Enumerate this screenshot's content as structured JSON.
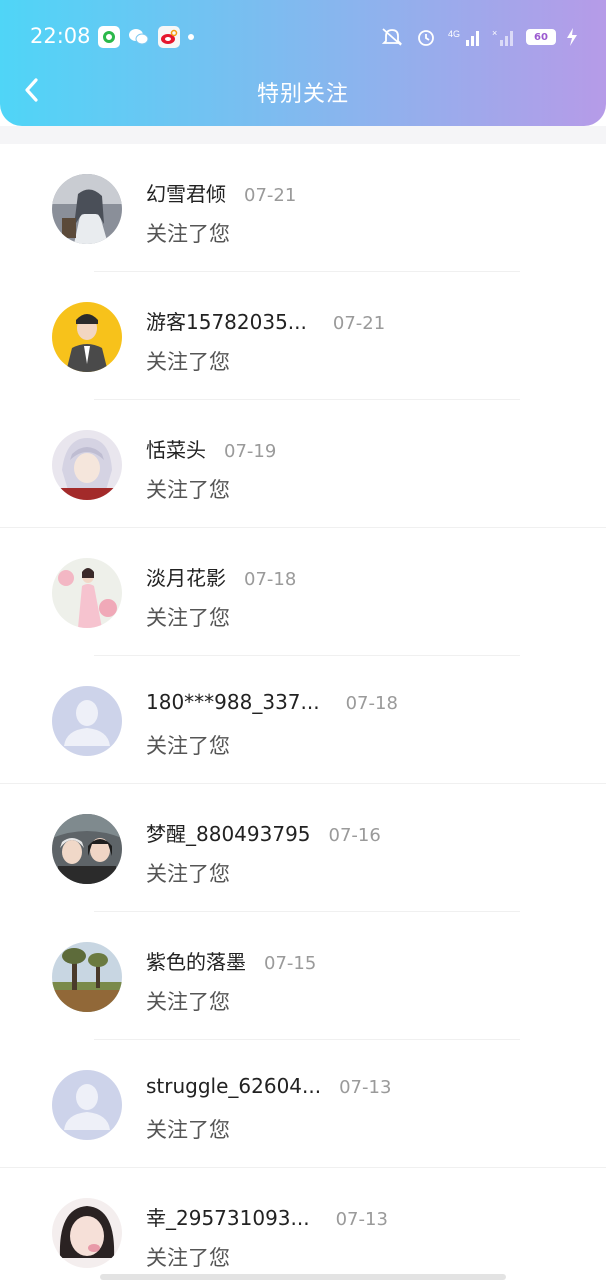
{
  "status_bar": {
    "time": "22:08",
    "notification_icons": [
      "app-icon-green",
      "wechat-icon",
      "weibo-icon"
    ],
    "network": "4G",
    "battery": "60"
  },
  "header": {
    "title": "特别关注",
    "back_icon": "chevron-left-icon",
    "gradient": [
      "#4fd5f7",
      "#b69be8"
    ]
  },
  "followers": [
    {
      "name": "幻雪君倾",
      "date": "07-21",
      "action": "关注了您"
    },
    {
      "name": "游客15782035...",
      "date": "07-21",
      "action": "关注了您"
    },
    {
      "name": "恬菜头",
      "date": "07-19",
      "action": "关注了您"
    },
    {
      "name": "淡月花影",
      "date": "07-18",
      "action": "关注了您"
    },
    {
      "name": "180***988_337...",
      "date": "07-18",
      "action": "关注了您"
    },
    {
      "name": "梦醒_880493795",
      "date": "07-16",
      "action": "关注了您"
    },
    {
      "name": "紫色的落墨",
      "date": "07-15",
      "action": "关注了您"
    },
    {
      "name": "struggle_62604...",
      "date": "07-13",
      "action": "关注了您"
    },
    {
      "name": "幸_295731093...",
      "date": "07-13",
      "action": "关注了您"
    }
  ]
}
